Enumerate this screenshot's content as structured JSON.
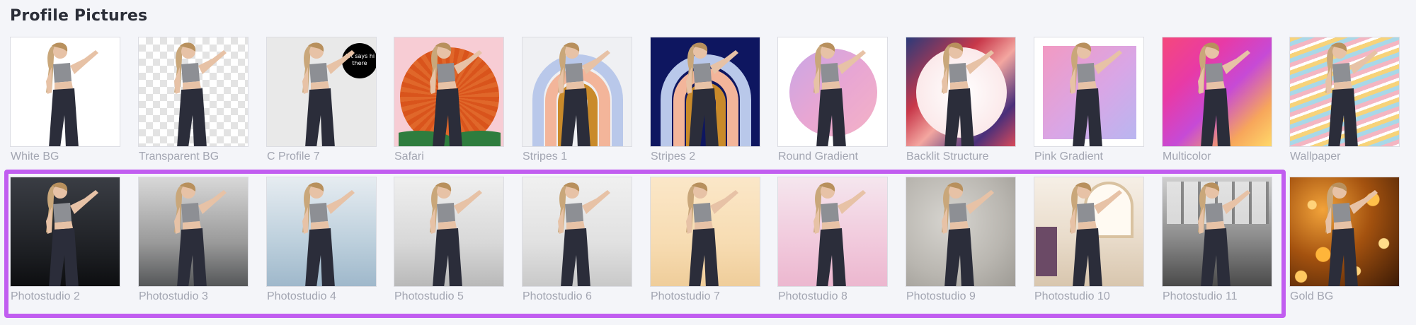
{
  "section": {
    "title": "Profile Pictures"
  },
  "rows": [
    {
      "tiles": [
        {
          "label": "White BG",
          "background": "white"
        },
        {
          "label": "Transparent BG",
          "background": "transparent"
        },
        {
          "label": "C Profile 7",
          "background": "cprofile",
          "badge_text": "Art says hi there"
        },
        {
          "label": "Safari",
          "background": "safari"
        },
        {
          "label": "Stripes 1",
          "background": "stripes1"
        },
        {
          "label": "Stripes 2",
          "background": "stripes2"
        },
        {
          "label": "Round Gradient",
          "background": "round"
        },
        {
          "label": "Backlit Structure",
          "background": "backlit"
        },
        {
          "label": "Pink Gradient",
          "background": "pinkgrad"
        },
        {
          "label": "Multicolor",
          "background": "multi"
        },
        {
          "label": "Wallpaper",
          "background": "wallpaper"
        }
      ]
    },
    {
      "tiles": [
        {
          "label": "Photostudio 2",
          "background": "ps2"
        },
        {
          "label": "Photostudio 3",
          "background": "ps3"
        },
        {
          "label": "Photostudio 4",
          "background": "ps4"
        },
        {
          "label": "Photostudio 5",
          "background": "ps5"
        },
        {
          "label": "Photostudio 6",
          "background": "ps6"
        },
        {
          "label": "Photostudio 7",
          "background": "ps7"
        },
        {
          "label": "Photostudio 8",
          "background": "ps8"
        },
        {
          "label": "Photostudio 9",
          "background": "ps9"
        },
        {
          "label": "Photostudio 10",
          "background": "ps10"
        },
        {
          "label": "Photostudio 11",
          "background": "ps11"
        },
        {
          "label": "Gold BG",
          "background": "gold"
        }
      ]
    }
  ],
  "selection": {
    "highlight_color": "#c15df0",
    "selected_row": 1,
    "selected_count": 10
  },
  "colors": {
    "page_bg": "#f4f5f9",
    "title": "#2b2e38",
    "label": "#a3a6b2"
  }
}
